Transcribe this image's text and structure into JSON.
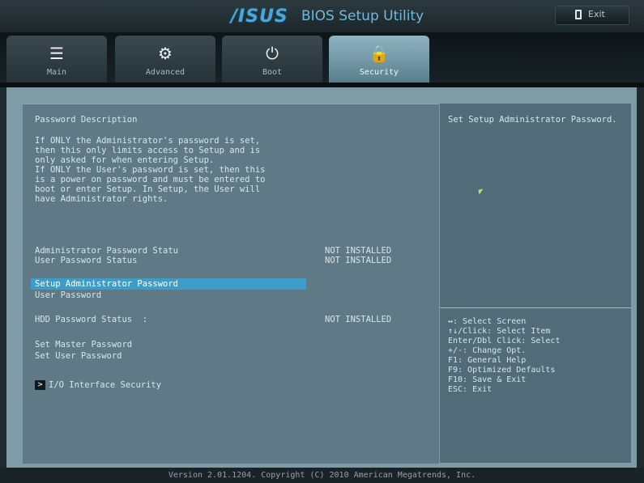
{
  "header": {
    "logo": "/ISUS",
    "title": "BIOS Setup Utility",
    "exit_label": "Exit"
  },
  "tabs": [
    {
      "label": "Main",
      "icon": "list-icon",
      "glyph": "☰"
    },
    {
      "label": "Advanced",
      "icon": "advanced-icon",
      "glyph": "⚙"
    },
    {
      "label": "Boot",
      "icon": "power-icon",
      "glyph": "⏻"
    },
    {
      "label": "Security",
      "icon": "lock-icon",
      "glyph": "🔒"
    }
  ],
  "content": {
    "section_title": "Password Description",
    "description": [
      "If ONLY the Administrator's password is set,",
      "then this only limits access to Setup and is",
      "only asked for when entering Setup.",
      "If ONLY the User's password is set, then this",
      "is a power on password and must be entered to",
      "boot or enter Setup. In Setup, the User will",
      "have Administrator rights."
    ],
    "admin_status_label": "Administrator Password Statu",
    "admin_status_value": "NOT INSTALLED",
    "user_status_label": "User Password Status",
    "user_status_value": "NOT INSTALLED",
    "setup_admin_password": "Setup Administrator Password",
    "user_password": "User Password",
    "hdd_status_label": "HDD Password Status  :",
    "hdd_status_value": "NOT INSTALLED",
    "set_master_password": "Set Master Password",
    "set_user_password": "Set User Password",
    "io_security": "I/O Interface Security",
    "submenu_glyph": ">"
  },
  "help": {
    "text": "Set Setup Administrator Password.",
    "keys": [
      "↔: Select Screen",
      "↑↓/Click: Select Item",
      "Enter/Dbl Click: Select",
      "+/-: Change Opt.",
      "F1: General Help",
      "F9: Optimized Defaults",
      "F10: Save & Exit",
      "ESC: Exit"
    ]
  },
  "footer": {
    "version": "Version 2.01.1204. Copyright (C) 2010 American Megatrends, Inc."
  }
}
